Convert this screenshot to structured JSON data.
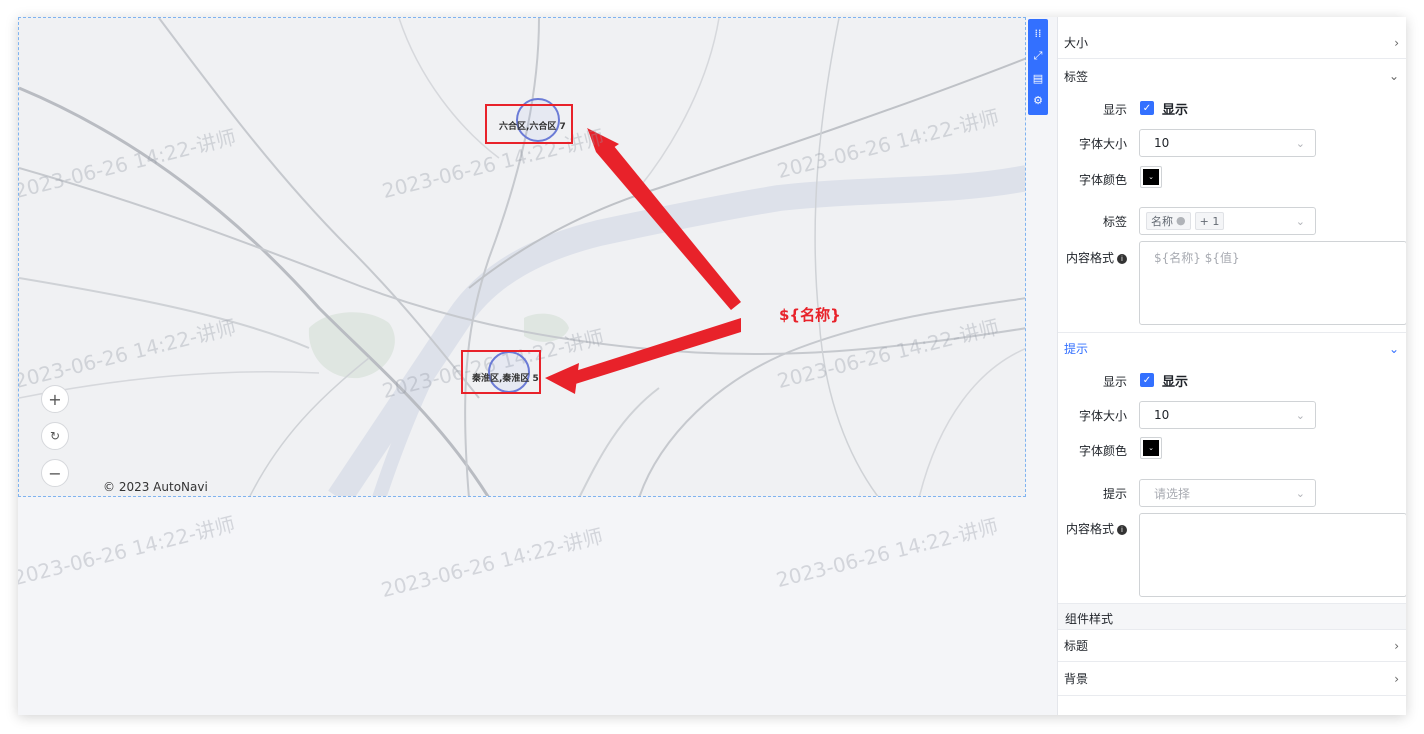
{
  "map": {
    "watermark_text": "2023-06-26 14:22-讲师",
    "copyright": "© 2023 AutoNavi",
    "points": [
      {
        "label": "六合区,六合区 7"
      },
      {
        "label": "秦淮区,秦淮区 5"
      }
    ],
    "annotation": "${名称}",
    "zoom_in": "+",
    "zoom_reset": "↻",
    "zoom_out": "−"
  },
  "panel": {
    "size_section": "大小",
    "label_section": {
      "title": "标签",
      "show_label": "显示",
      "show_checkbox_text": "显示",
      "font_size_label": "字体大小",
      "font_size_value": "10",
      "font_color_label": "字体颜色",
      "tag_label": "标签",
      "tag_chip": "名称",
      "tag_more": "+ 1",
      "format_label": "内容格式",
      "format_placeholder": "${名称} ${值}"
    },
    "tooltip_section": {
      "title": "提示",
      "show_label": "显示",
      "show_checkbox_text": "显示",
      "font_size_label": "字体大小",
      "font_size_value": "10",
      "font_color_label": "字体颜色",
      "tip_label": "提示",
      "tip_placeholder": "请选择",
      "format_label": "内容格式"
    },
    "component_style": "组件样式",
    "title_section": "标题",
    "background_section": "背景"
  },
  "colors": {
    "accent": "#3370ff",
    "annotation_red": "#e8222a"
  }
}
